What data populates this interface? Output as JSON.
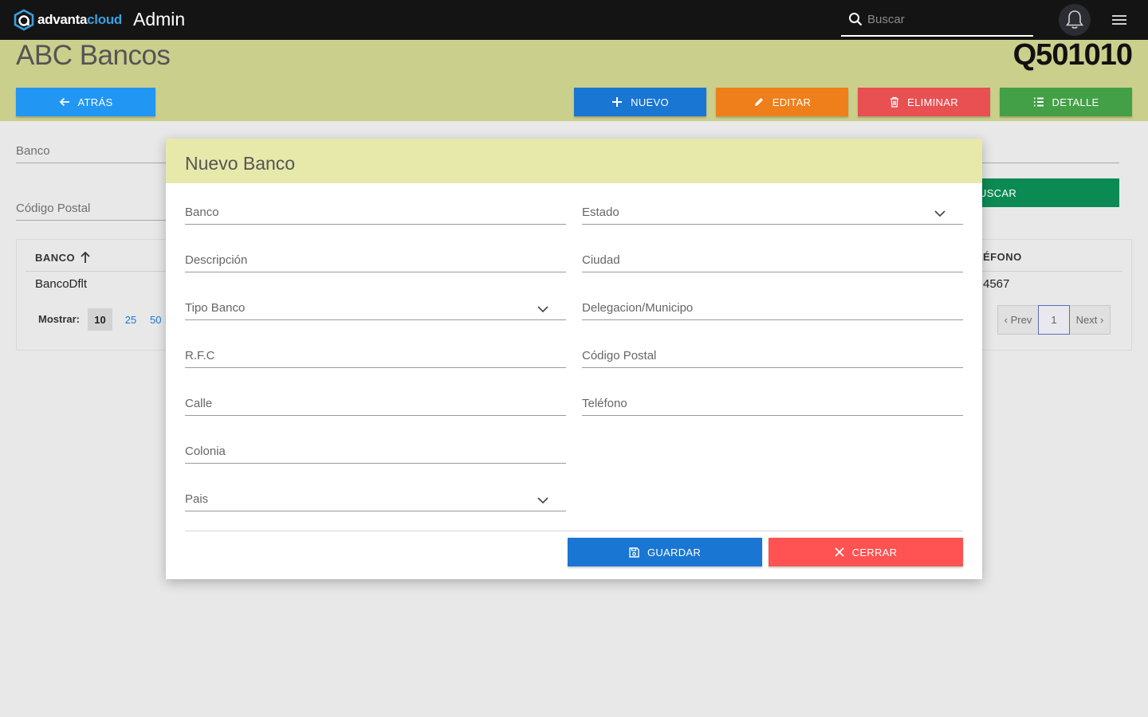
{
  "topbar": {
    "logo_part1": "advanta",
    "logo_part2": "cloud",
    "app_title": "Admin",
    "search_placeholder": "Buscar"
  },
  "header": {
    "title": "ABC Bancos",
    "code": "Q501010",
    "back_label": "ATRÁS",
    "new_label": "NUEVO",
    "edit_label": "EDITAR",
    "delete_label": "ELIMINAR",
    "detail_label": "DETALLE"
  },
  "filters": {
    "banco_label": "Banco",
    "cp_label": "Código Postal",
    "search_label": "USCAR"
  },
  "table": {
    "col_banco": "BANCO",
    "col_telefono": "ÉFONO",
    "rows": [
      {
        "banco": "BancoDflt",
        "telefono": "4567"
      }
    ],
    "show_label": "Mostrar:",
    "page_sizes": [
      "10",
      "25",
      "50"
    ],
    "prev_label": "‹ Prev",
    "current_page": "1",
    "next_label": "Next ›"
  },
  "modal": {
    "title": "Nuevo Banco",
    "left_fields": [
      "Banco",
      "Descripción",
      "Tipo Banco",
      "R.F.C",
      "Calle",
      "Colonia",
      "Pais"
    ],
    "right_fields": [
      "Estado",
      "Ciudad",
      "Delegacion/Municipo",
      "Código Postal",
      "Teléfono"
    ],
    "save_label": "GUARDAR",
    "close_label": "CERRAR"
  },
  "colors": {
    "topbar": "#141414",
    "band": "#cbcf8c",
    "modal_head": "#e6e9aa",
    "primary": "#1976d2",
    "orange": "#ef7f1a",
    "red": "#e85052",
    "green": "#43a047",
    "close_red": "#ff5252"
  }
}
